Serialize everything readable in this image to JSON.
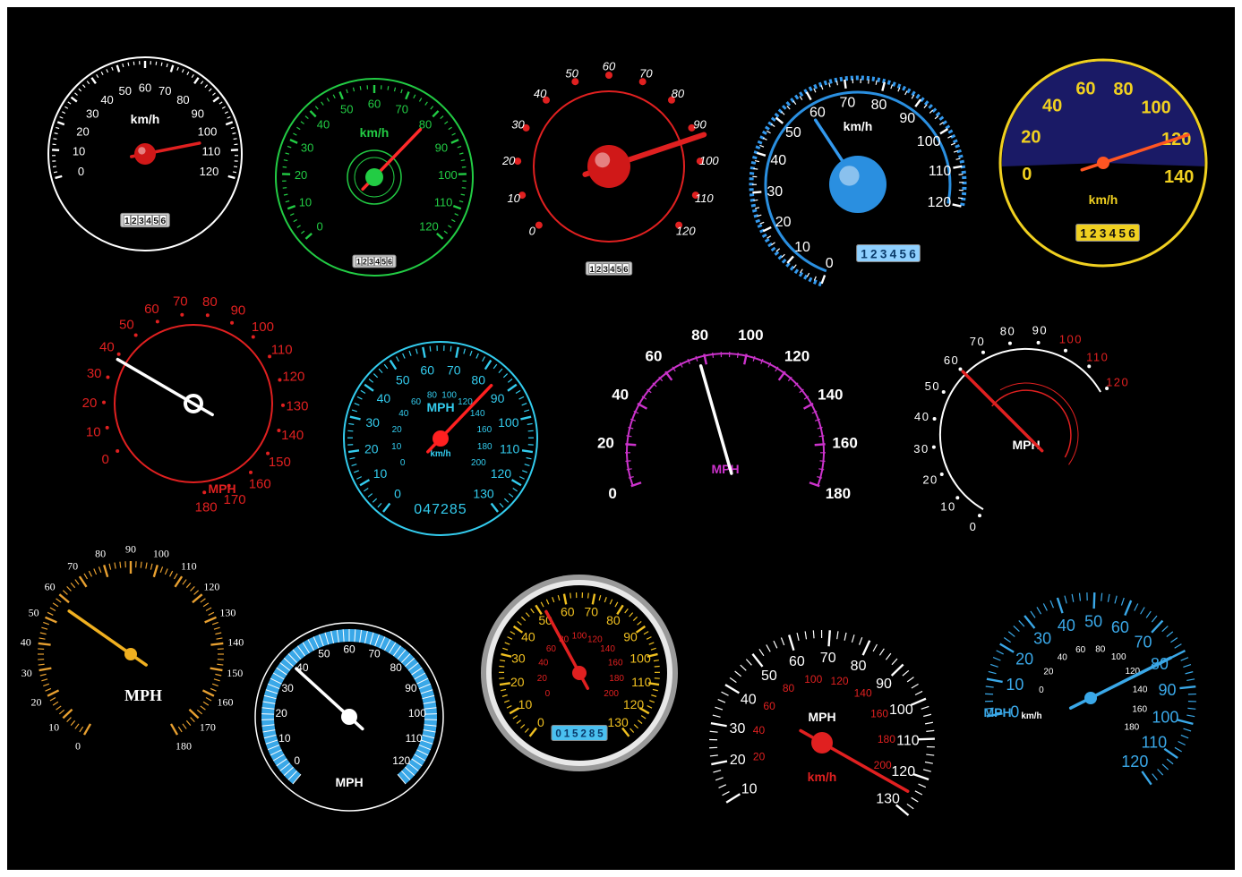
{
  "gauges": [
    {
      "id": "g1",
      "ticks": [
        "0",
        "10",
        "20",
        "30",
        "40",
        "50",
        "60",
        "70",
        "80",
        "90",
        "100",
        "110",
        "120"
      ],
      "unit": "km/h",
      "odometer": "123456",
      "colors": {
        "ring": "#ffffff",
        "ticks": "#ffffff",
        "labels": "#ffffff",
        "needle": "#e02020",
        "hub": "#d01818"
      },
      "needle_value": 105,
      "min": 0,
      "max": 120
    },
    {
      "id": "g2",
      "ticks": [
        "0",
        "10",
        "20",
        "30",
        "40",
        "50",
        "60",
        "70",
        "80",
        "90",
        "100",
        "110",
        "120"
      ],
      "unit": "km/h",
      "odometer": "123456",
      "colors": {
        "ring": "#22cc44",
        "ticks": "#22cc44",
        "labels": "#22cc44",
        "needle": "#ff2a2a",
        "hub": "#22cc44"
      },
      "needle_value": 80,
      "min": 0,
      "max": 120
    },
    {
      "id": "g3",
      "ticks": [
        "0",
        "10",
        "20",
        "30",
        "40",
        "50",
        "60",
        "70",
        "80",
        "90",
        "100",
        "110",
        "120"
      ],
      "odometer": "123456",
      "colors": {
        "ring": "#e02020",
        "ticks": "#e02020",
        "labels": "#ffffff",
        "needle": "#e02020",
        "hub": "#d01818"
      },
      "needle_value": 93,
      "min": 0,
      "max": 120
    },
    {
      "id": "g4",
      "ticks": [
        "0",
        "10",
        "20",
        "30",
        "40",
        "50",
        "60",
        "70",
        "80",
        "90",
        "100",
        "110",
        "120"
      ],
      "unit": "km/h",
      "odometer": "123456",
      "colors": {
        "ring": "#3399ee",
        "ticks": "#ffffff",
        "labels": "#ffffff",
        "needle": "#3399ee",
        "hub": "#2a8fe0"
      },
      "needle_value": 58,
      "min": 0,
      "max": 120
    },
    {
      "id": "g5",
      "ticks": [
        "0",
        "20",
        "40",
        "60",
        "80",
        "100",
        "120",
        "140"
      ],
      "unit": "km/h",
      "odometer": "123456",
      "colors": {
        "ring": "#f0d020",
        "ticks": "#f0d020",
        "labels": "#f0d020",
        "needle": "#ff5522",
        "hub": "#ff5522",
        "face": "#1a1a66"
      },
      "needle_value": 120,
      "min": 0,
      "max": 140
    },
    {
      "id": "g6",
      "ticks": [
        "0",
        "10",
        "20",
        "30",
        "40",
        "50",
        "60",
        "70",
        "80",
        "90",
        "100",
        "110",
        "120",
        "130",
        "140",
        "150",
        "160",
        "170",
        "180"
      ],
      "unit": "MPH",
      "colors": {
        "ring": "#e02020",
        "ticks": "#e02020",
        "labels": "#e02020",
        "needle": "#ffffff",
        "hub": "#ffffff"
      },
      "needle_value": 38,
      "min": 0,
      "max": 180
    },
    {
      "id": "g7",
      "ticks": [
        "0",
        "10",
        "20",
        "30",
        "40",
        "50",
        "60",
        "70",
        "80",
        "90",
        "100",
        "110",
        "120",
        "130"
      ],
      "inner_ticks": [
        "0",
        "10",
        "20",
        "40",
        "60",
        "80",
        "100",
        "120",
        "140",
        "160",
        "180",
        "200"
      ],
      "unit": "MPH",
      "unit2": "km/h",
      "odometer": "047285",
      "colors": {
        "ring": "#33ccee",
        "ticks": "#33ccee",
        "labels": "#33ccee",
        "needle": "#ff2020",
        "hub": "#ff2020"
      },
      "needle_value": 85,
      "min": 0,
      "max": 130
    },
    {
      "id": "g8",
      "ticks": [
        "0",
        "20",
        "40",
        "60",
        "80",
        "100",
        "120",
        "140",
        "160",
        "180"
      ],
      "unit": "MPH",
      "colors": {
        "ring": "#cc33cc",
        "ticks": "#cc33cc",
        "labels": "#ffffff",
        "needle": "#ffffff",
        "unit_color": "#cc33cc"
      },
      "needle_value": 77,
      "min": 0,
      "max": 180
    },
    {
      "id": "g9",
      "ticks": [
        "0",
        "10",
        "20",
        "30",
        "40",
        "50",
        "60",
        "70",
        "80",
        "90",
        "100",
        "110",
        "120"
      ],
      "unit": "MPH",
      "colors": {
        "ring": "#ffffff",
        "ticks": "#ffffff",
        "labels": "#ffffff",
        "labels_hot": "#e02020",
        "needle": "#e02020"
      },
      "needle_value": 60,
      "min": 0,
      "max": 120
    },
    {
      "id": "g10",
      "ticks": [
        "0",
        "10",
        "20",
        "30",
        "40",
        "50",
        "60",
        "70",
        "80",
        "90",
        "100",
        "110",
        "120",
        "130",
        "140",
        "150",
        "160",
        "170",
        "180"
      ],
      "unit": "MPH",
      "colors": {
        "ticks": "#e8a030",
        "labels": "#ffffff",
        "needle": "#f0b020",
        "hub": "#f0b020"
      },
      "needle_value": 57,
      "min": 0,
      "max": 180
    },
    {
      "id": "g11",
      "ticks": [
        "0",
        "10",
        "20",
        "30",
        "40",
        "50",
        "60",
        "70",
        "80",
        "90",
        "100",
        "110",
        "120"
      ],
      "unit": "MPH",
      "colors": {
        "ring": "#ffffff",
        "band": "#3aa8e8",
        "labels": "#ffffff",
        "needle": "#ffffff",
        "hub": "#ffffff"
      },
      "needle_value": 38,
      "min": 0,
      "max": 120
    },
    {
      "id": "g12",
      "ticks": [
        "0",
        "10",
        "20",
        "30",
        "40",
        "50",
        "60",
        "70",
        "80",
        "90",
        "100",
        "110",
        "120",
        "130"
      ],
      "inner_ticks": [
        "0",
        "20",
        "40",
        "60",
        "80",
        "100",
        "120",
        "140",
        "160",
        "180",
        "200"
      ],
      "odometer": "015285",
      "colors": {
        "ring": "#cccccc",
        "ticks": "#f0c020",
        "labels": "#f0c020",
        "inner": "#e02020",
        "needle": "#e02020",
        "hub": "#e02020"
      },
      "needle_value": 52,
      "min": 0,
      "max": 130
    },
    {
      "id": "g13",
      "ticks": [
        "10",
        "20",
        "30",
        "40",
        "50",
        "60",
        "70",
        "80",
        "90",
        "100",
        "110",
        "120",
        "130"
      ],
      "inner_ticks": [
        "20",
        "40",
        "60",
        "80",
        "100",
        "120",
        "140",
        "160",
        "180",
        "200"
      ],
      "unit": "MPH",
      "unit2": "km/h",
      "colors": {
        "ticks": "#ffffff",
        "labels": "#ffffff",
        "inner": "#e02020",
        "needle": "#e02020",
        "hub": "#e02020"
      },
      "needle_value": 125,
      "min": 10,
      "max": 130
    },
    {
      "id": "g14",
      "ticks": [
        "0",
        "10",
        "20",
        "30",
        "40",
        "50",
        "60",
        "70",
        "80",
        "90",
        "100",
        "110",
        "120"
      ],
      "inner_ticks": [
        "0",
        "20",
        "40",
        "60",
        "80",
        "100",
        "120",
        "140",
        "160",
        "180"
      ],
      "unit": "MPH",
      "unit2": "km/h",
      "colors": {
        "ticks": "#3aa8e8",
        "labels": "#3aa8e8",
        "inner": "#ffffff",
        "needle": "#3aa8e8",
        "hub": "#3aa8e8"
      },
      "needle_value": 80,
      "min": 0,
      "max": 120
    }
  ]
}
